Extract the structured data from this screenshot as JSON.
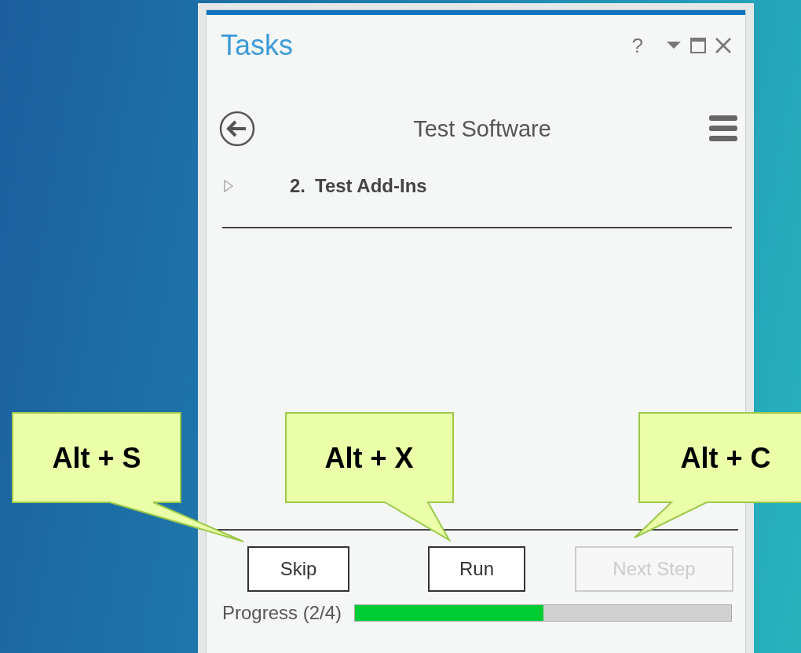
{
  "pane": {
    "title": "Tasks",
    "help": "?"
  },
  "task": {
    "title": "Test Software"
  },
  "step": {
    "number": "2.",
    "label": "Test Add-Ins",
    "expanded": false
  },
  "buttons": [
    {
      "label": "Skip",
      "disabled": false,
      "shortcut": "Alt + S"
    },
    {
      "label": "Run",
      "disabled": false,
      "shortcut": "Alt + X"
    },
    {
      "label": "Next Step",
      "disabled": true,
      "shortcut": "Alt + C"
    }
  ],
  "progress": {
    "label": "Progress (2/4)",
    "level": 0.5
  }
}
